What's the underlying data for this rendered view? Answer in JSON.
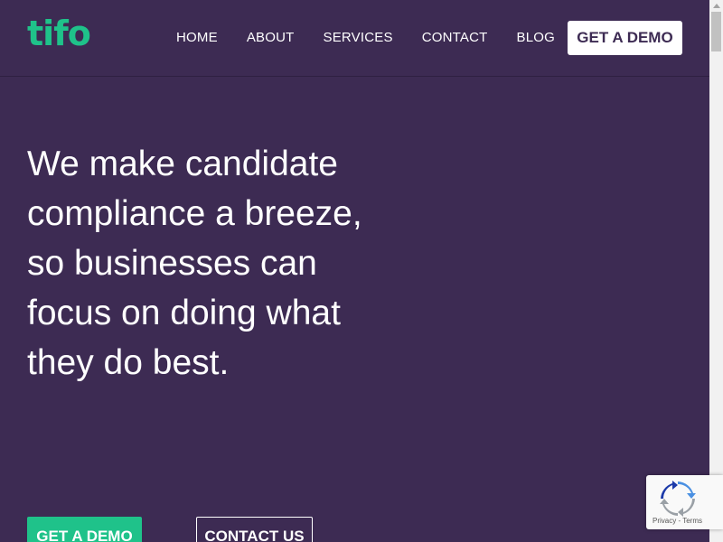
{
  "header": {
    "logo_text": "tifo",
    "nav": [
      {
        "label": "HOME"
      },
      {
        "label": "ABOUT"
      },
      {
        "label": "SERVICES"
      },
      {
        "label": "CONTACT"
      },
      {
        "label": "BLOG"
      }
    ],
    "demo_button": "GET A DEMO"
  },
  "hero": {
    "title": "We make candidate compliance a breeze, so businesses can focus on doing what they do best.",
    "primary_cta": "GET A DEMO",
    "secondary_cta": "CONTACT US"
  },
  "recaptcha": {
    "privacy": "Privacy",
    "separator": " - ",
    "terms": "Terms"
  },
  "colors": {
    "background": "#3d2b53",
    "accent": "#1fc28a",
    "text": "#ffffff"
  },
  "icons": {
    "recaptcha": "recaptcha-icon"
  }
}
